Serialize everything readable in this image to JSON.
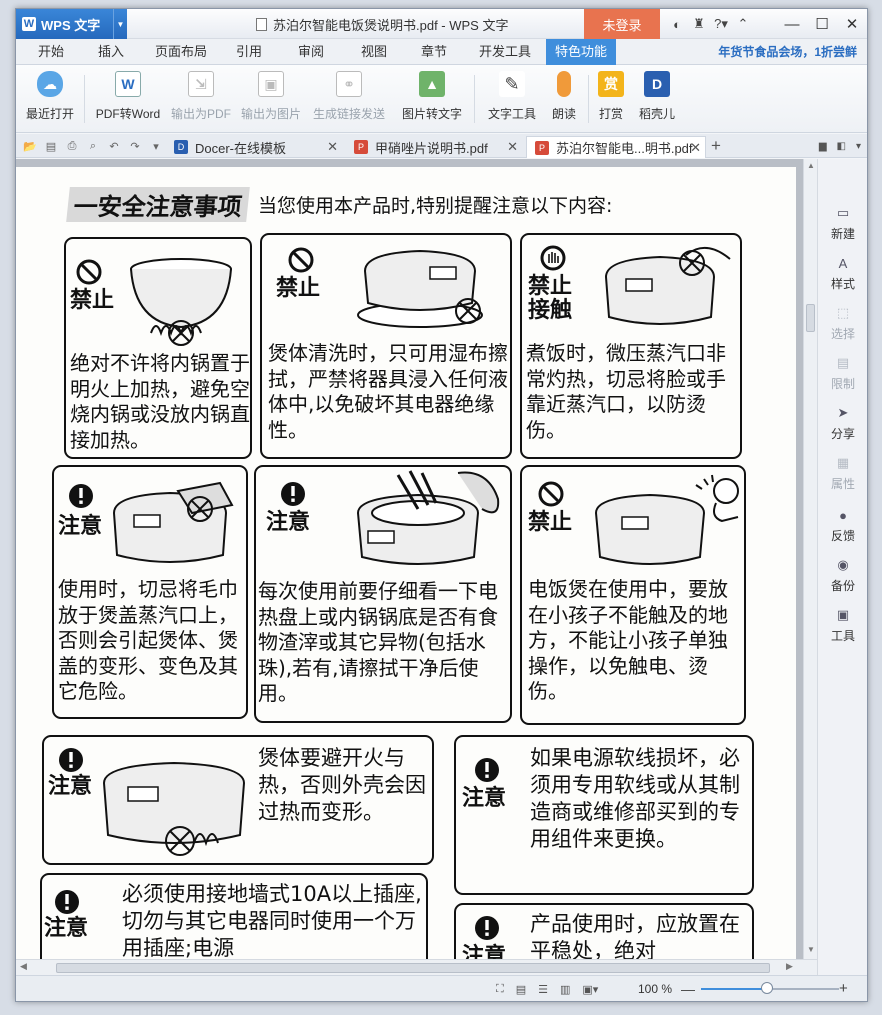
{
  "app": {
    "name": "WPS 文字",
    "doc_title": "苏泊尔智能电饭煲说明书.pdf - WPS 文字",
    "login_label": "未登录",
    "promo_text": "年货节食品会场，1折尝鲜"
  },
  "menu": {
    "tabs": [
      "开始",
      "插入",
      "页面布局",
      "引用",
      "审阅",
      "视图",
      "章节",
      "开发工具",
      "特色功能"
    ],
    "active": "特色功能"
  },
  "ribbon": {
    "buttons": [
      {
        "label": "最近打开",
        "icon": "cloud-icon",
        "enabled": true
      },
      {
        "label": "PDF转Word",
        "icon": "pdf-to-word-icon",
        "enabled": true
      },
      {
        "label": "输出为PDF",
        "icon": "export-pdf-icon",
        "enabled": false
      },
      {
        "label": "输出为图片",
        "icon": "export-image-icon",
        "enabled": false
      },
      {
        "label": "生成链接发送",
        "icon": "link-send-icon",
        "enabled": false
      },
      {
        "label": "图片转文字",
        "icon": "image-to-text-icon",
        "enabled": true
      },
      {
        "label": "文字工具",
        "icon": "text-tools-icon",
        "enabled": true
      },
      {
        "label": "朗读",
        "icon": "microphone-icon",
        "enabled": true
      },
      {
        "label": "打赏",
        "icon": "reward-icon",
        "enabled": true
      },
      {
        "label": "稻壳儿",
        "icon": "docer-icon",
        "enabled": true
      }
    ],
    "reward_glyph": "赏",
    "docer_glyph": "D"
  },
  "doc_tabs": [
    {
      "label": "Docer-在线模板",
      "icon": "docer-icon",
      "active": false
    },
    {
      "label": "甲硝唑片说明书.pdf",
      "icon": "pdf-icon",
      "active": false
    },
    {
      "label": "苏泊尔智能电...明书.pdf",
      "icon": "pdf-icon",
      "active": true
    }
  ],
  "right_panel": [
    {
      "label": "新建",
      "icon": "new-doc-icon",
      "enabled": true
    },
    {
      "label": "样式",
      "icon": "style-icon",
      "enabled": true
    },
    {
      "label": "选择",
      "icon": "select-icon",
      "enabled": false
    },
    {
      "label": "限制",
      "icon": "restrict-icon",
      "enabled": false
    },
    {
      "label": "分享",
      "icon": "share-icon",
      "enabled": true
    },
    {
      "label": "属性",
      "icon": "properties-icon",
      "enabled": false
    },
    {
      "label": "反馈",
      "icon": "feedback-icon",
      "enabled": true
    },
    {
      "label": "备份",
      "icon": "backup-icon",
      "enabled": true
    },
    {
      "label": "工具",
      "icon": "toolbox-icon",
      "enabled": true
    }
  ],
  "status": {
    "zoom": "100 %",
    "zoom_fraction": 0.48
  },
  "manual": {
    "heading": "一安全注意事项",
    "subheading": "当您使用本产品时,特别提醒注意以下内容:",
    "panels": [
      {
        "label": "禁止",
        "symbol": "prohibit",
        "text": "绝对不许将内锅置于明火上加热，避免空烧内锅或没放内锅直接加热。"
      },
      {
        "label": "禁止",
        "symbol": "prohibit",
        "text": "煲体清洗时，只可用湿布擦拭，严禁将器具浸入任何液体中,以免破坏其电器绝缘性。"
      },
      {
        "label": "禁止接触",
        "symbol": "no-touch",
        "text": "煮饭时，微压蒸汽口非常灼热，切忌将脸或手靠近蒸汽口，以防烫伤。"
      },
      {
        "label": "注意",
        "symbol": "caution",
        "text": "使用时，切忌将毛巾放于煲盖蒸汽口上，否则会引起煲体、煲盖的变形、变色及其它危险。"
      },
      {
        "label": "注意",
        "symbol": "caution",
        "text": "每次使用前要仔细看一下电热盘上或内锅锅底是否有食物渣滓或其它异物(包括水珠),若有,请擦拭干净后使用。"
      },
      {
        "label": "禁止",
        "symbol": "prohibit",
        "text": "电饭煲在使用中，要放在小孩子不能触及的地方，不能让小孩子单独操作，以免触电、烫伤。"
      },
      {
        "label": "注意",
        "symbol": "caution",
        "text": "煲体要避开火与热，否则外壳会因过热而变形。"
      },
      {
        "label": "注意",
        "symbol": "caution",
        "text": "如果电源软线损坏，必须用专用软线或从其制造商或维修部买到的专用组件来更换。"
      },
      {
        "label": "注意",
        "symbol": "caution",
        "text": "必须使用接地墙式10A以上插座,切勿与其它电器同时使用一个万用插座;电源"
      },
      {
        "label": "注意",
        "symbol": "caution",
        "text": "产品使用时，应放置在平稳处，绝对"
      }
    ]
  }
}
